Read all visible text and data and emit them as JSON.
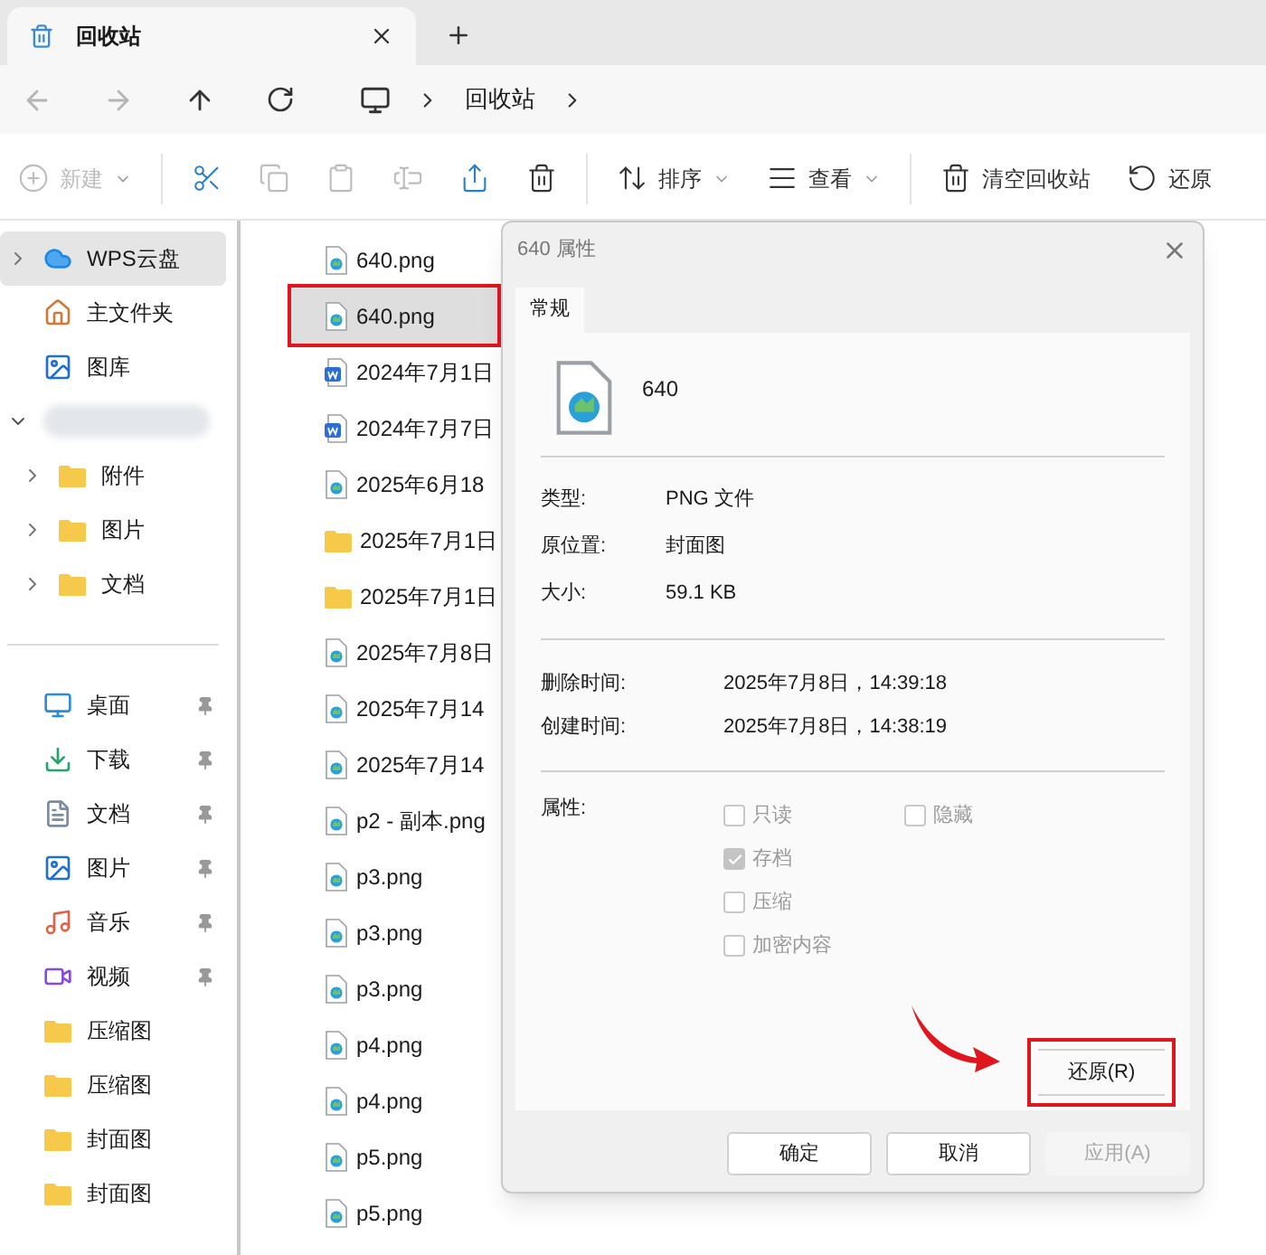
{
  "tab": {
    "title": "回收站",
    "selected": true
  },
  "breadcrumb": [
    "回收站"
  ],
  "toolbar": [
    {
      "kind": "new",
      "label": "新建",
      "disabled": true
    },
    {
      "kind": "cut",
      "disabled": false
    },
    {
      "kind": "copy",
      "disabled": true
    },
    {
      "kind": "paste",
      "disabled": true
    },
    {
      "kind": "rename",
      "disabled": true
    },
    {
      "kind": "share",
      "disabled": false
    },
    {
      "kind": "delete",
      "disabled": false
    },
    {
      "kind": "sort",
      "label": "排序",
      "disabled": false
    },
    {
      "kind": "view",
      "label": "查看",
      "disabled": false
    },
    {
      "kind": "empty",
      "label": "清空回收站",
      "disabled": false
    },
    {
      "kind": "restore",
      "label": "还原",
      "disabled": false
    }
  ],
  "sidebar": {
    "items": [
      {
        "kind": "cloud",
        "label": "WPS云盘",
        "selected": true,
        "expanded": false
      },
      {
        "kind": "home",
        "label": "主文件夹",
        "selected": false
      },
      {
        "kind": "gallery",
        "label": "图库",
        "selected": false
      },
      {
        "kind": "redacted",
        "selected": false,
        "expanded": true,
        "children": [
          {
            "kind": "folder",
            "label": "附件",
            "selected": false,
            "expanded": false
          },
          {
            "kind": "folder",
            "label": "图片",
            "selected": false,
            "expanded": false
          },
          {
            "kind": "folder",
            "label": "文档",
            "selected": false,
            "expanded": false
          }
        ]
      }
    ],
    "quick_access": [
      {
        "kind": "desktop",
        "label": "桌面",
        "pinned": true
      },
      {
        "kind": "download",
        "label": "下载",
        "pinned": true
      },
      {
        "kind": "document",
        "label": "文档",
        "pinned": true
      },
      {
        "kind": "picture",
        "label": "图片",
        "pinned": true
      },
      {
        "kind": "music",
        "label": "音乐",
        "pinned": true
      },
      {
        "kind": "video",
        "label": "视频",
        "pinned": true
      },
      {
        "kind": "folder",
        "label": "压缩图",
        "pinned": false
      },
      {
        "kind": "folder",
        "label": "压缩图",
        "pinned": false
      },
      {
        "kind": "folder",
        "label": "封面图",
        "pinned": false
      },
      {
        "kind": "folder",
        "label": "封面图",
        "pinned": false
      }
    ]
  },
  "files": [
    {
      "kind": "image",
      "name": "640.png",
      "selected": false,
      "highlighted": false
    },
    {
      "kind": "image",
      "name": "640.png",
      "selected": true,
      "highlighted": true
    },
    {
      "kind": "word",
      "name": "2024年7月1日",
      "selected": false,
      "highlighted": false
    },
    {
      "kind": "word",
      "name": "2024年7月7日",
      "selected": false,
      "highlighted": false
    },
    {
      "kind": "image",
      "name": "2025年6月18",
      "selected": false,
      "highlighted": false
    },
    {
      "kind": "folder",
      "name": "2025年7月1日",
      "selected": false,
      "highlighted": false
    },
    {
      "kind": "folder",
      "name": "2025年7月1日",
      "selected": false,
      "highlighted": false
    },
    {
      "kind": "image",
      "name": "2025年7月8日",
      "selected": false,
      "highlighted": false
    },
    {
      "kind": "image",
      "name": "2025年7月14",
      "selected": false,
      "highlighted": false
    },
    {
      "kind": "image",
      "name": "2025年7月14",
      "selected": false,
      "highlighted": false
    },
    {
      "kind": "image",
      "name": "p2 - 副本.png",
      "selected": false,
      "highlighted": false
    },
    {
      "kind": "image",
      "name": "p3.png",
      "selected": false,
      "highlighted": false
    },
    {
      "kind": "image",
      "name": "p3.png",
      "selected": false,
      "highlighted": false
    },
    {
      "kind": "image",
      "name": "p3.png",
      "selected": false,
      "highlighted": false
    },
    {
      "kind": "image",
      "name": "p4.png",
      "selected": false,
      "highlighted": false
    },
    {
      "kind": "image",
      "name": "p4.png",
      "selected": false,
      "highlighted": false
    },
    {
      "kind": "image",
      "name": "p5.png",
      "selected": false,
      "highlighted": false
    },
    {
      "kind": "image",
      "name": "p5.png",
      "selected": false,
      "highlighted": false
    }
  ],
  "dialog": {
    "title": "640 属性",
    "tabs": [
      {
        "label": "常规",
        "selected": true
      }
    ],
    "file_name": "640",
    "info": [
      {
        "label": "类型:",
        "value": "PNG 文件"
      },
      {
        "label": "原位置:",
        "value": "封面图"
      },
      {
        "label": "大小:",
        "value": "59.1 KB"
      }
    ],
    "times": [
      {
        "label": "删除时间:",
        "value": "2025年7月8日，14:39:18"
      },
      {
        "label": "创建时间:",
        "value": "2025年7月8日，14:38:19"
      }
    ],
    "attributes_label": "属性:",
    "attributes": [
      [
        {
          "label": "只读",
          "checked": false,
          "disabled": true
        },
        {
          "label": "隐藏",
          "checked": false,
          "disabled": true
        }
      ],
      [
        {
          "label": "存档",
          "checked": true,
          "disabled": true
        }
      ],
      [
        {
          "label": "压缩",
          "checked": false,
          "disabled": true
        }
      ],
      [
        {
          "label": "加密内容",
          "checked": false,
          "disabled": true
        }
      ]
    ],
    "restore_button": {
      "label": "还原(R)",
      "highlighted": true
    },
    "buttons": [
      {
        "label": "确定",
        "disabled": false
      },
      {
        "label": "取消",
        "disabled": false
      },
      {
        "label": "应用(A)",
        "disabled": true
      }
    ]
  }
}
